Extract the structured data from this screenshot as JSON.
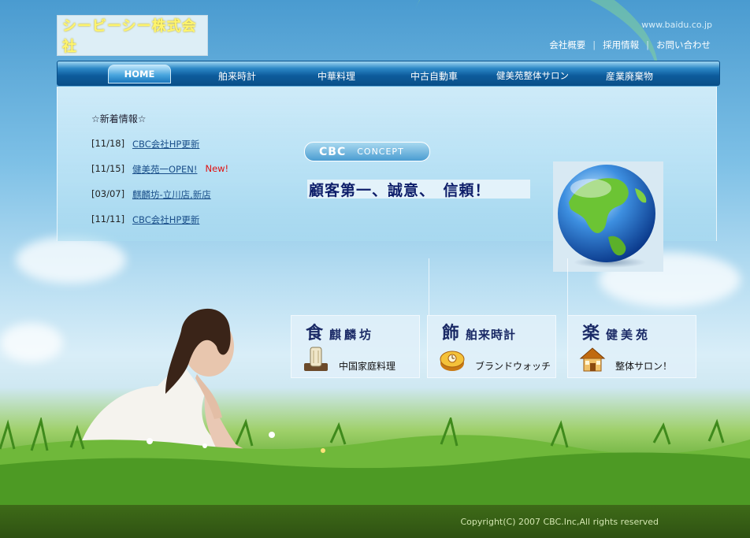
{
  "header": {
    "logo_text": "シービーシー株式会社",
    "site_url": "www.baidu.co.jp",
    "links": [
      "会社概要",
      "採用情報",
      "お問い合わせ"
    ]
  },
  "nav": {
    "items": [
      "HOME",
      "舶来時計",
      "中華料理",
      "中古自動車",
      "健美苑整体サロン",
      "産業廃棄物"
    ],
    "active": "HOME"
  },
  "news": {
    "heading": "☆新着情報☆",
    "items": [
      {
        "date": "[11/18]",
        "title": "CBC会社HP更新",
        "badge": ""
      },
      {
        "date": "[11/15]",
        "title": "健美苑一OPEN!",
        "badge": "New!"
      },
      {
        "date": "[03/07]",
        "title": "麒麟坊-立川店,新店",
        "badge": ""
      },
      {
        "date": "[11/11]",
        "title": "CBC会社HP更新",
        "badge": ""
      }
    ]
  },
  "concept": {
    "label_main": "CBC",
    "label_sub": "CONCEPT",
    "slogan": "顧客第一、誠意、　信頼！"
  },
  "cards": [
    {
      "char": "食",
      "name": "麒麟坊",
      "subtitle": "中国家庭料理",
      "icon": "scroll-icon"
    },
    {
      "char": "飾",
      "name": "舶来時計",
      "subtitle": "ブランドウォッチ",
      "icon": "watch-box-icon"
    },
    {
      "char": "楽",
      "name": "健美苑",
      "subtitle": "整体サロン！",
      "icon": "house-icon"
    }
  ],
  "footer": {
    "copyright": "Copyright(C) 2007 CBC.Inc,All rights reserved"
  },
  "colors": {
    "nav_dark": "#0a4f89",
    "logo_text": "#fff56e",
    "slogan_text": "#0e1e6a",
    "news_new": "#e01010"
  }
}
